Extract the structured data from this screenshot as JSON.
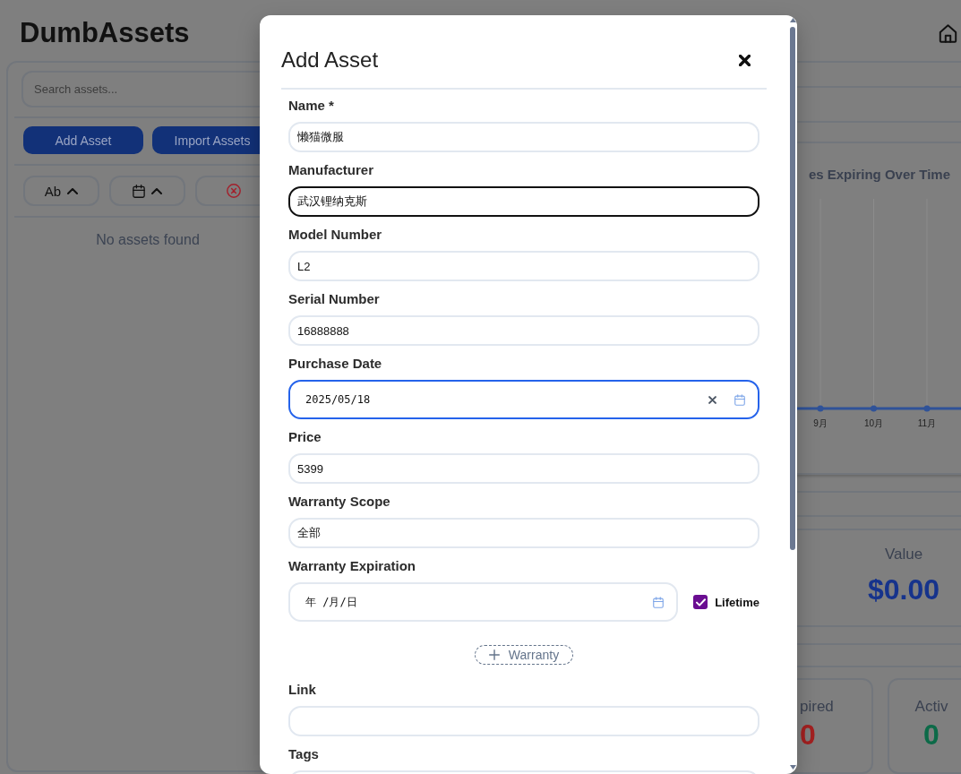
{
  "header": {
    "title": "DumbAssets"
  },
  "sidebar": {
    "search": {
      "placeholder": "Search assets..."
    },
    "buttons": [
      {
        "label": "Add Asset"
      },
      {
        "label": "Import Assets"
      }
    ],
    "sort_buttons": [
      {
        "kind": "name",
        "label": "Ab",
        "ascending": true
      },
      {
        "kind": "date",
        "ascending": true
      },
      {
        "kind": "reset"
      }
    ],
    "empty_message": "No assets found"
  },
  "dashboard": {
    "chart": {
      "title": "es Expiring Over Time",
      "x_labels": [
        "9月",
        "10月",
        "11月"
      ]
    },
    "summary": {
      "label": "Value",
      "amount": "$0.00"
    },
    "status_cards": [
      {
        "label": "pired",
        "count": "0",
        "color": "#a32020"
      },
      {
        "label": "Activ",
        "count": "0",
        "color": "#0c6a48"
      }
    ]
  },
  "modal": {
    "title": "Add Asset",
    "fields": [
      {
        "kind": "text",
        "label": "Name *",
        "value": "懒猫微服",
        "focused": false,
        "hovered": false
      },
      {
        "kind": "text",
        "label": "Manufacturer",
        "value": "武汉锂纳克斯",
        "focused": true,
        "hovered": false
      },
      {
        "kind": "text",
        "label": "Model Number",
        "value": "L2",
        "focused": false,
        "hovered": false
      },
      {
        "kind": "text",
        "label": "Serial Number",
        "value": "16888888",
        "focused": false,
        "hovered": false
      },
      {
        "kind": "date",
        "label": "Purchase Date",
        "value": "2025/05/18",
        "focused": false,
        "hovered": true
      },
      {
        "kind": "text",
        "label": "Price",
        "value": "5399",
        "focused": false,
        "hovered": false
      },
      {
        "kind": "text",
        "label": "Warranty Scope",
        "value": "全部",
        "focused": false,
        "hovered": false
      },
      {
        "kind": "date",
        "label": "Warranty Expiration",
        "placeholder": "年 /月/日",
        "focused": false,
        "hovered": false,
        "lifetime": {
          "label": "Lifetime",
          "checked": true
        }
      },
      {
        "kind": "button",
        "label": "Warranty"
      },
      {
        "kind": "text",
        "label": "Link",
        "focused": false,
        "hovered": false
      },
      {
        "kind": "text",
        "label": "Tags",
        "focused": false,
        "hovered": false
      }
    ]
  }
}
